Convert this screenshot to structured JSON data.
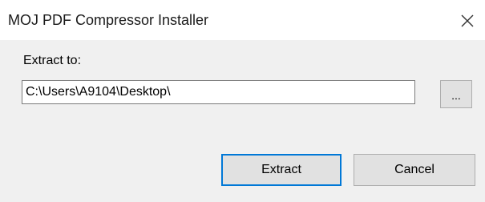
{
  "window": {
    "title": "MOJ PDF Compressor Installer",
    "close_icon": "close-icon"
  },
  "form": {
    "extract_label": "Extract to:",
    "path_value": "C:\\Users\\A9104\\Desktop\\",
    "browse_label": "..."
  },
  "buttons": {
    "extract_label": "Extract",
    "cancel_label": "Cancel"
  },
  "colors": {
    "dialog_bg": "#f0f0f0",
    "title_bg": "#ffffff",
    "button_bg": "#e1e1e1",
    "default_button_border": "#0078d7"
  }
}
